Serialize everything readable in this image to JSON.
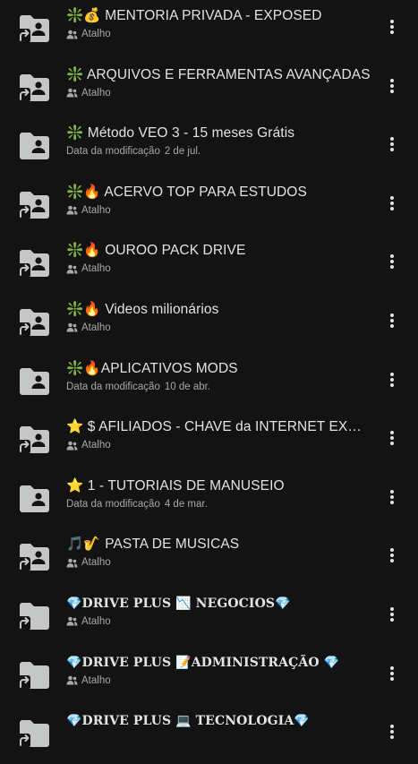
{
  "colors": {
    "background": "#131314",
    "text_primary": "#e3e3e3",
    "text_secondary": "#a8a8a8",
    "folder_icon": "#c4c7c5"
  },
  "files": [
    {
      "title": "❇️💰 MENTORIA PRIVADA - EXPOSED",
      "sub_label": "Atalho",
      "sub_date": "",
      "shortcut": true,
      "style": "normal"
    },
    {
      "title": "❇️ ARQUIVOS E FERRAMENTAS AVANÇADAS",
      "sub_label": "Atalho",
      "sub_date": "",
      "shortcut": true,
      "style": "normal"
    },
    {
      "title": "❇️ Método VEO 3 - 15 meses Grátis",
      "sub_label": "Data da modificação",
      "sub_date": "2 de jul.",
      "shortcut": false,
      "style": "normal"
    },
    {
      "title": "❇️🔥 ACERVO TOP PARA ESTUDOS",
      "sub_label": "Atalho",
      "sub_date": "",
      "shortcut": true,
      "style": "normal"
    },
    {
      "title": "❇️🔥 OUROO PACK DRIVE",
      "sub_label": "Atalho",
      "sub_date": "",
      "shortcut": true,
      "style": "normal"
    },
    {
      "title": "❇️🔥 Videos milionários",
      "sub_label": "Atalho",
      "sub_date": "",
      "shortcut": true,
      "style": "normal"
    },
    {
      "title": "❇️🔥APLICATIVOS MODS",
      "sub_label": "Data da modificação",
      "sub_date": "10 de abr.",
      "shortcut": false,
      "style": "normal"
    },
    {
      "title": "⭐ $ AFILIADOS -  CHAVE da INTERNET EXPOSED",
      "sub_label": "Atalho",
      "sub_date": "",
      "shortcut": true,
      "style": "normal"
    },
    {
      "title": "⭐ 1 - TUTORIAIS DE MANUSEIO",
      "sub_label": "Data da modificação",
      "sub_date": "4 de mar.",
      "shortcut": false,
      "style": "normal"
    },
    {
      "title": "🎵🎷 PASTA DE MUSICAS",
      "sub_label": "Atalho",
      "sub_date": "",
      "shortcut": true,
      "style": "normal"
    },
    {
      "title": "💎DRIVE PLUS 📉 NEGOCIOS💎",
      "sub_label": "Atalho",
      "sub_date": "",
      "shortcut": true,
      "style": "bold",
      "plain_folder": true
    },
    {
      "title": "💎DRIVE PLUS 📝ADMINISTRAÇÃO   💎",
      "sub_label": "Atalho",
      "sub_date": "",
      "shortcut": true,
      "style": "bold",
      "plain_folder": true
    },
    {
      "title": "💎DRIVE PLUS 💻 TECNOLOGIA💎",
      "sub_label": "",
      "sub_date": "",
      "shortcut": true,
      "style": "bold",
      "plain_folder": true
    }
  ]
}
